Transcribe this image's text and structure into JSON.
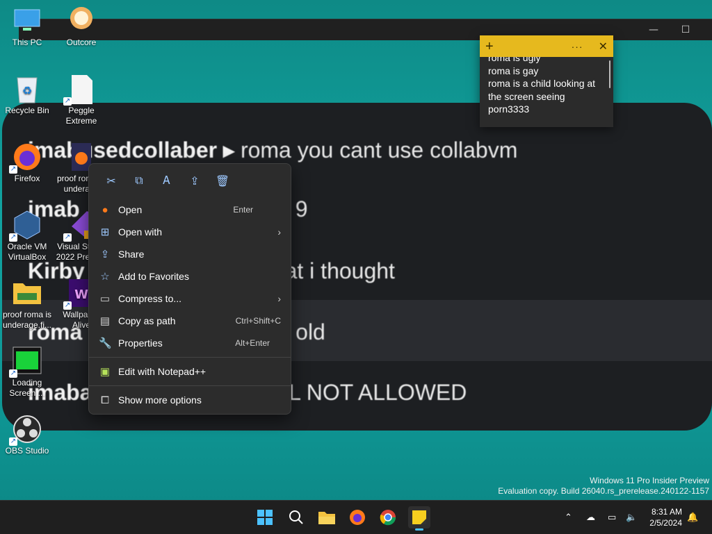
{
  "desktop_icons": [
    {
      "label": "This PC"
    },
    {
      "label": "Outcore"
    },
    {
      "label": "Recycle Bin"
    },
    {
      "label": "Peggle Extreme"
    },
    {
      "label": "Firefox"
    },
    {
      "label": "proof roma is underage"
    },
    {
      "label": "Oracle VM VirtualBox"
    },
    {
      "label": "Visual Studio 2022 Preview"
    },
    {
      "label": "proof roma is underage.fi..."
    },
    {
      "label": "Wallpaper Alive"
    },
    {
      "label": "Loading Screen ..."
    },
    {
      "label": "OBS Studio"
    }
  ],
  "chat_lines": [
    {
      "name": "imabusedcollaber ▸",
      "text": " roma you cant use collabvm"
    },
    {
      "name": "imab",
      "text": "UR 9"
    },
    {
      "name": "Kirby",
      "text": "hat i thought"
    },
    {
      "name": "roma",
      "text": "s old"
    },
    {
      "name": "imaba",
      "text": "LL NOT ALLOWED"
    }
  ],
  "context_menu": {
    "toolbar": [
      "cut-icon",
      "copy-icon",
      "rename-icon",
      "share-icon",
      "delete-icon"
    ],
    "items": [
      {
        "label": "Open",
        "shortcut": "Enter",
        "icon": "firefox-icon"
      },
      {
        "label": "Open with",
        "shortcut": "",
        "icon": "open-with-icon",
        "submenu": true
      },
      {
        "label": "Share",
        "shortcut": "",
        "icon": "share-icon"
      },
      {
        "label": "Add to Favorites",
        "shortcut": "",
        "icon": "star-icon"
      },
      {
        "label": "Compress to...",
        "shortcut": "",
        "icon": "zip-icon",
        "submenu": true
      },
      {
        "label": "Copy as path",
        "shortcut": "Ctrl+Shift+C",
        "icon": "path-icon"
      },
      {
        "label": "Properties",
        "shortcut": "Alt+Enter",
        "icon": "wrench-icon"
      }
    ],
    "extra_items": [
      {
        "label": "Edit with Notepad++",
        "icon": "notepadpp-icon"
      },
      {
        "label": "Show more options",
        "icon": "more-options-icon"
      }
    ]
  },
  "sticky_note": {
    "lines": [
      "roma is ugly",
      "roma is gay",
      "roma is a child looking at",
      "the screen seeing",
      "porn3333"
    ],
    "header_color": "#e6b91e"
  },
  "watermark": {
    "line1": "Windows 11 Pro Insider Preview",
    "line2": "Evaluation copy. Build 26040.rs_prerelease.240122-1157"
  },
  "clock": {
    "time": "8:31 AM",
    "date": "2/5/2024"
  }
}
